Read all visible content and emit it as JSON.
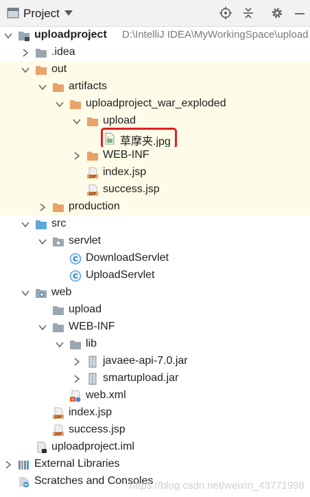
{
  "header": {
    "title": "Project"
  },
  "tree": [
    {
      "label": "uploadproject",
      "extra": "D:\\IntelliJ IDEA\\MyWorkingSpace\\upload",
      "depth": 0,
      "arrow": "down",
      "icon": "module-folder",
      "bold": true,
      "highlight": false
    },
    {
      "label": ".idea",
      "depth": 1,
      "arrow": "right",
      "icon": "folder-gray",
      "highlight": false
    },
    {
      "label": "out",
      "depth": 1,
      "arrow": "down",
      "icon": "folder-orange",
      "highlight": true
    },
    {
      "label": "artifacts",
      "depth": 2,
      "arrow": "down",
      "icon": "folder-orange",
      "highlight": true
    },
    {
      "label": "uploadproject_war_exploded",
      "depth": 3,
      "arrow": "down",
      "icon": "folder-orange",
      "highlight": true
    },
    {
      "label": "upload",
      "depth": 4,
      "arrow": "down",
      "icon": "folder-orange",
      "highlight": true
    },
    {
      "label": "草摩夹.jpg",
      "depth": 5,
      "arrow": "none",
      "icon": "image-file",
      "highlight": true,
      "selected": true
    },
    {
      "label": "WEB-INF",
      "depth": 4,
      "arrow": "right",
      "icon": "folder-orange",
      "highlight": true
    },
    {
      "label": "index.jsp",
      "depth": 4,
      "arrow": "none",
      "icon": "jsp-file",
      "highlight": true
    },
    {
      "label": "success.jsp",
      "depth": 4,
      "arrow": "none",
      "icon": "jsp-file",
      "highlight": true
    },
    {
      "label": "production",
      "depth": 2,
      "arrow": "right",
      "icon": "folder-orange",
      "highlight": true
    },
    {
      "label": "src",
      "depth": 1,
      "arrow": "down",
      "icon": "folder-blue",
      "highlight": false
    },
    {
      "label": "servlet",
      "depth": 2,
      "arrow": "down",
      "icon": "package",
      "highlight": false
    },
    {
      "label": "DownloadServlet",
      "depth": 3,
      "arrow": "none",
      "icon": "class-file",
      "highlight": false
    },
    {
      "label": "UploadServlet",
      "depth": 3,
      "arrow": "none",
      "icon": "class-file",
      "highlight": false
    },
    {
      "label": "web",
      "depth": 1,
      "arrow": "down",
      "icon": "web-folder",
      "highlight": false
    },
    {
      "label": "upload",
      "depth": 2,
      "arrow": "none",
      "icon": "folder-gray",
      "highlight": false
    },
    {
      "label": "WEB-INF",
      "depth": 2,
      "arrow": "down",
      "icon": "folder-gray",
      "highlight": false
    },
    {
      "label": "lib",
      "depth": 3,
      "arrow": "down",
      "icon": "folder-gray",
      "highlight": false
    },
    {
      "label": "javaee-api-7.0.jar",
      "depth": 4,
      "arrow": "right",
      "icon": "jar-file",
      "highlight": false
    },
    {
      "label": "smartupload.jar",
      "depth": 4,
      "arrow": "right",
      "icon": "jar-file",
      "highlight": false
    },
    {
      "label": "web.xml",
      "depth": 3,
      "arrow": "none",
      "icon": "xml-file",
      "highlight": false
    },
    {
      "label": "index.jsp",
      "depth": 2,
      "arrow": "none",
      "icon": "jsp-file",
      "highlight": false
    },
    {
      "label": "success.jsp",
      "depth": 2,
      "arrow": "none",
      "icon": "jsp-file",
      "highlight": false
    },
    {
      "label": "uploadproject.iml",
      "depth": 1,
      "arrow": "none",
      "icon": "iml-file",
      "highlight": false
    },
    {
      "label": "External Libraries",
      "depth": 0,
      "arrow": "right",
      "icon": "libraries",
      "highlight": false
    },
    {
      "label": "Scratches and Consoles",
      "depth": 0,
      "arrow": "none",
      "icon": "scratches",
      "highlight": false
    }
  ],
  "watermark": "https://blog.csdn.net/weixin_43771998",
  "colors": {
    "highlight_row": "#fefce8",
    "folder_orange": "#e8a36b",
    "folder_gray": "#9aa7b0",
    "folder_blue": "#5ea8d9",
    "selection_border": "#e0201b"
  }
}
